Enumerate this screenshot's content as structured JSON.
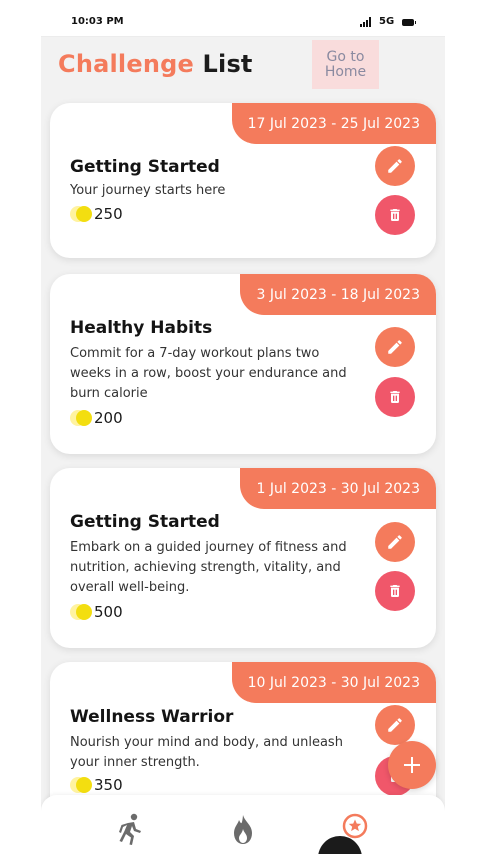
{
  "status_bar": {
    "time": "10:03 PM",
    "network": "5G",
    "signal_icon": "signal-icon",
    "battery_icon": "battery-icon"
  },
  "header": {
    "title_accent": "Challenge",
    "title_rest": "List",
    "home_button_label": "Go to Home"
  },
  "colors": {
    "accent": "#f47b5c",
    "delete": "#f0576a",
    "date_pill_text": "#ffffff",
    "home_button_bg": "#f9dcdc",
    "coin": "#f3de10"
  },
  "challenges": [
    {
      "date_range": "17 Jul 2023 - 25 Jul 2023",
      "title": "Getting Started",
      "description": "Your journey starts here",
      "points": "250"
    },
    {
      "date_range": "3 Jul 2023 - 18 Jul 2023",
      "title": "Healthy Habits",
      "description": "Commit for a 7-day workout plans two weeks in a row, boost your endurance and burn calorie",
      "points": "200"
    },
    {
      "date_range": "1 Jul 2023 - 30 Jul 2023",
      "title": "Getting Started",
      "description": "Embark on a guided journey of fitness and nutrition, achieving strength, vitality, and overall well-being.",
      "points": "500"
    },
    {
      "date_range": "10 Jul 2023 - 30 Jul 2023",
      "title": "Wellness Warrior",
      "description": "Nourish your mind and body, and unleash your inner strength.",
      "points": "350"
    }
  ],
  "card_icons": {
    "edit": "pencil-icon",
    "delete": "trash-icon",
    "points": "coin-icon"
  },
  "fab_icon": "plus-icon",
  "bottom_nav": [
    {
      "icon": "running-icon"
    },
    {
      "icon": "flame-icon"
    },
    {
      "icon": "star-badge-icon"
    }
  ]
}
